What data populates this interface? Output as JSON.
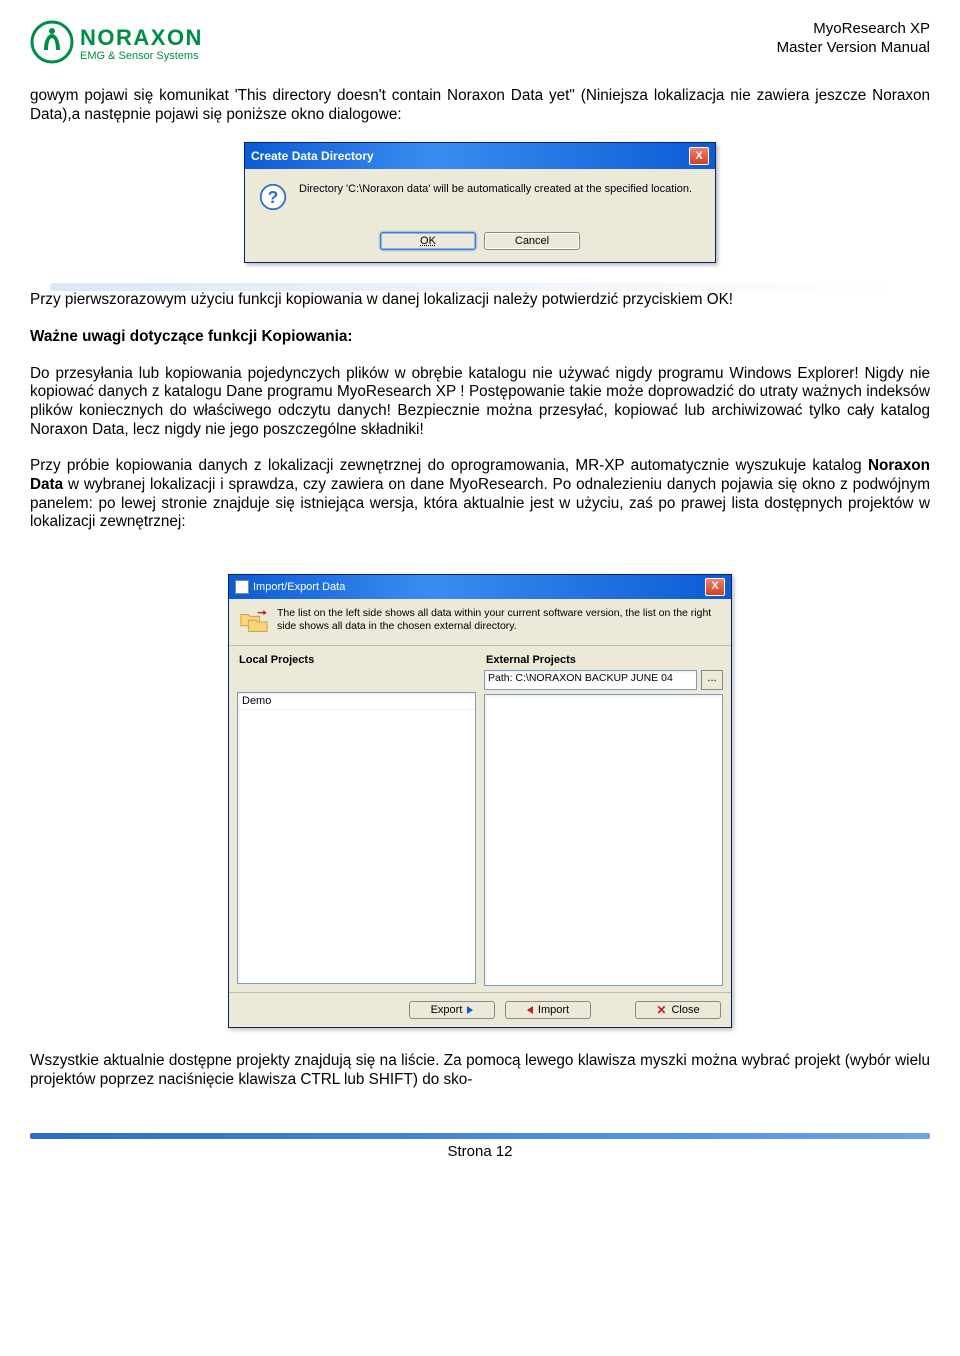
{
  "header": {
    "logo_line1": "NORAXON",
    "logo_line2": "EMG & Sensor Systems",
    "right_line1": "MyoResearch XP",
    "right_line2": "Master Version Manual"
  },
  "paragraphs": {
    "p1": "gowym pojawi się komunikat 'This directory doesn't contain Noraxon Data yet\" (Niniejsza lokalizacja nie zawiera jeszcze Noraxon Data),a następnie pojawi się poniższe okno dialogowe:",
    "p2": "Przy pierwszorazowym użyciu funkcji kopiowania w danej lokalizacji należy potwierdzić przyciskiem OK!",
    "p3_bold": "Ważne uwagi dotyczące funkcji Kopiowania:",
    "p4": "Do przesyłania lub kopiowania pojedynczych plików w obrębie katalogu nie używać nigdy programu Windows Explorer! Nigdy nie kopiować danych z katalogu Dane programu MyoResearch XP ! Postępowanie takie może doprowadzić do utraty ważnych indeksów plików koniecznych do właściwego odczytu danych! Bezpiecznie można przesyłać, kopiować lub archiwizować tylko cały katalog Noraxon Data, lecz nigdy nie jego poszczególne składniki!",
    "p5_a": "Przy próbie kopiowania danych z lokalizacji zewnętrznej do oprogramowania, MR-XP automatycznie wyszukuje katalog ",
    "p5_bold": "Noraxon Data",
    "p5_b": " w wybranej lokalizacji i sprawdza, czy zawiera on dane MyoResearch. Po odnalezieniu danych pojawia się okno z podwójnym panelem: po lewej stronie znajduje się istniejąca wersja, która aktualnie jest w użyciu, zaś po prawej lista dostępnych projektów w lokalizacji zewnętrznej:",
    "p6": "Wszystkie aktualnie dostępne projekty znajdują się na liście. Za pomocą lewego klawisza myszki można wybrać projekt (wybór wielu projektów poprzez naciśnięcie klawisza CTRL lub SHIFT) do sko-"
  },
  "dialog1": {
    "title": "Create Data Directory",
    "message": "Directory 'C:\\Noraxon data' will be automatically created at the specified location.",
    "ok": "OK",
    "cancel": "Cancel",
    "close_x": "X"
  },
  "dialog2": {
    "title": "Import/Export Data",
    "info": "The list on the left side shows all data within your current software version, the list on the right side shows all data in the chosen external directory.",
    "local_label": "Local Projects",
    "external_label": "External Projects",
    "path_prefix": "Path: C:\\NORAXON BACKUP JUNE 04",
    "local_items": [
      "Demo"
    ],
    "dots": "...",
    "export": "Export",
    "import": "Import",
    "close": "Close",
    "close_x": "X"
  },
  "footer": {
    "page": "Strona 12"
  }
}
